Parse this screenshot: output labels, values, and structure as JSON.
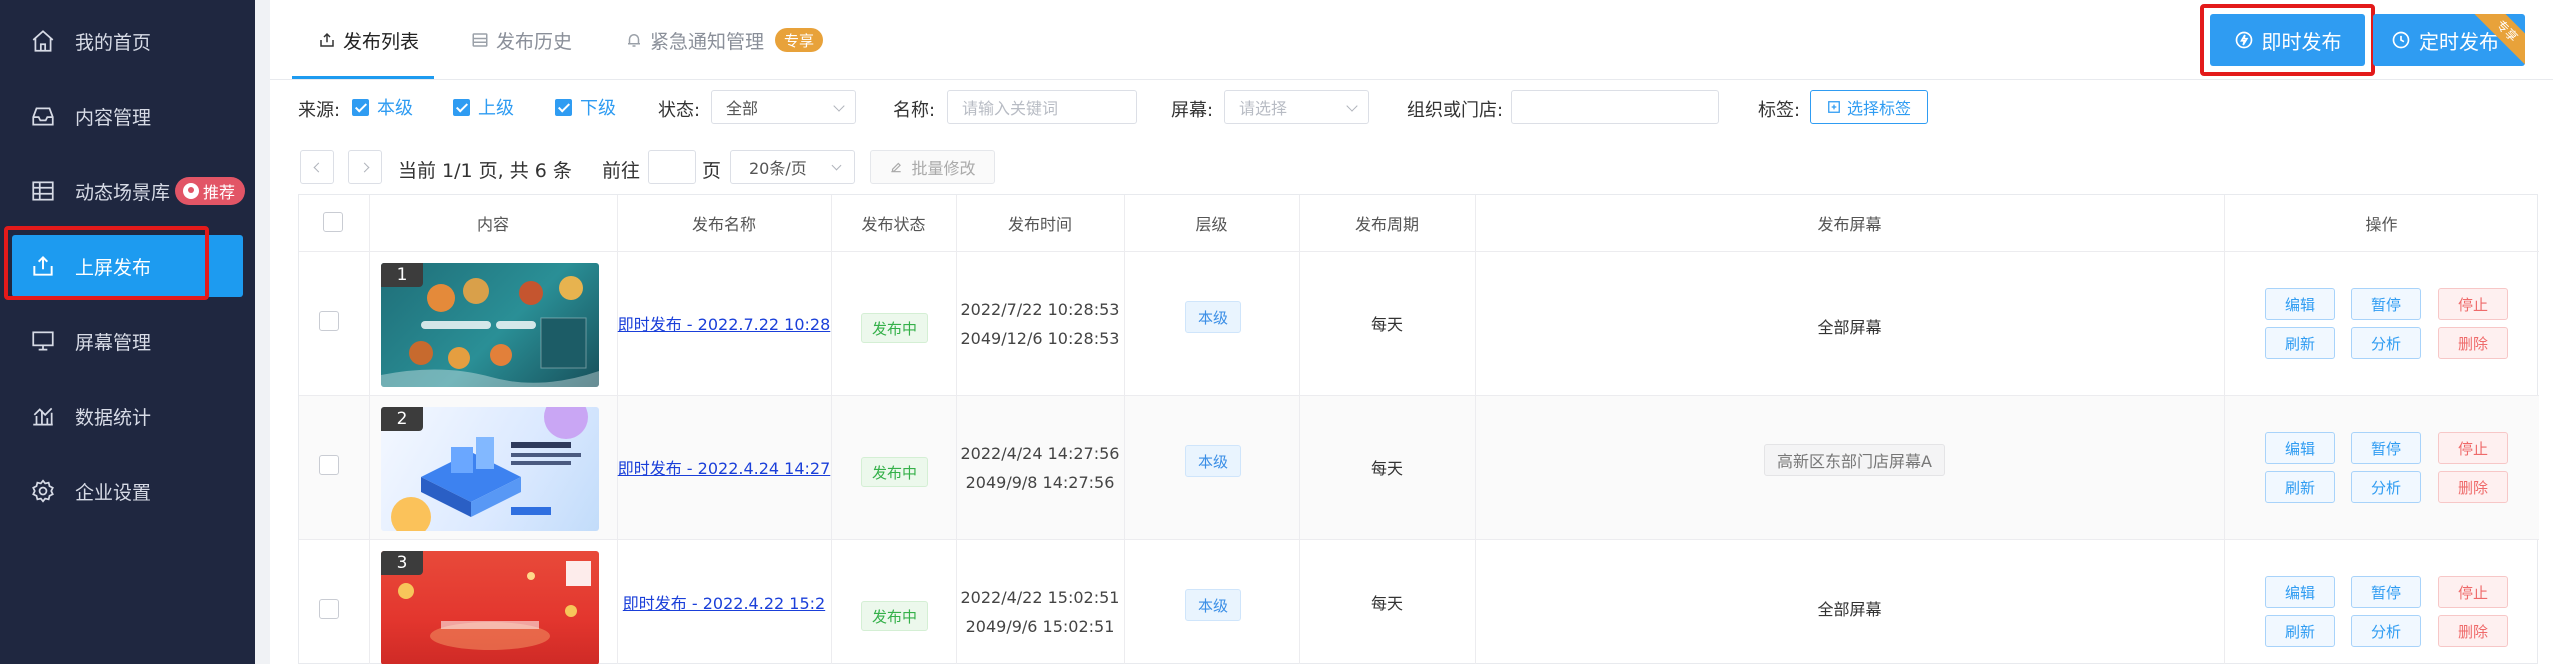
{
  "sidebar": {
    "items": [
      {
        "label": "我的首页",
        "icon": "home-icon"
      },
      {
        "label": "内容管理",
        "icon": "inbox-icon"
      },
      {
        "label": "动态场景库",
        "icon": "table-icon"
      },
      {
        "label": "上屏发布",
        "icon": "upload-icon"
      },
      {
        "label": "屏幕管理",
        "icon": "monitor-icon"
      },
      {
        "label": "数据统计",
        "icon": "chart-icon"
      },
      {
        "label": "企业设置",
        "icon": "gear-icon"
      }
    ],
    "active_index": 3,
    "recommend_badge": "推荐"
  },
  "tabs": {
    "items": [
      {
        "label": "发布列表",
        "icon": "upload-small-icon"
      },
      {
        "label": "发布历史",
        "icon": "history-icon"
      },
      {
        "label": "紧急通知管理",
        "icon": "bell-icon"
      }
    ],
    "exclusive_badge": "专享"
  },
  "actions": {
    "publish_now": "即时发布",
    "publish_timed": "定时发布",
    "timed_corner": "专享"
  },
  "filters": {
    "source_label": "来源:",
    "source_options": [
      "本级",
      "上级",
      "下级"
    ],
    "status_label": "状态:",
    "status_value": "全部",
    "name_label": "名称:",
    "name_placeholder": "请输入关键词",
    "screen_label": "屏幕:",
    "screen_placeholder": "请选择",
    "org_label": "组织或门店:",
    "tag_label": "标签:",
    "tag_button": "选择标签"
  },
  "pagination": {
    "summary": "当前 1/1 页, 共 6 条",
    "goto_label": "前往",
    "page_unit": "页",
    "page_size": "20条/页",
    "batch_edit": "批量修改"
  },
  "table": {
    "headers": [
      "内容",
      "发布名称",
      "发布状态",
      "发布时间",
      "层级",
      "发布周期",
      "发布屏幕",
      "操作"
    ],
    "ops": [
      "编辑",
      "暂停",
      "停止",
      "刷新",
      "分析",
      "删除"
    ],
    "rows": [
      {
        "num": "1",
        "name": "即时发布 - 2022.7.22 10:28",
        "status": "发布中",
        "start": "2022/7/22 10:28:53",
        "end": "2049/12/6 10:28:53",
        "level": "本级",
        "cycle": "每天",
        "screen": "全部屏幕"
      },
      {
        "num": "2",
        "name": "即时发布 - 2022.4.24 14:27",
        "status": "发布中",
        "start": "2022/4/24 14:27:56",
        "end": "2049/9/8 14:27:56",
        "level": "本级",
        "cycle": "每天",
        "screen": "高新区东部门店屏幕A"
      },
      {
        "num": "3",
        "name": "即时发布 - 2022.4.22 15:2",
        "status": "发布中",
        "start": "2022/4/22 15:02:51",
        "end": "2049/9/6 15:02:51",
        "level": "本级",
        "cycle": "每天",
        "screen": "全部屏幕"
      }
    ]
  }
}
